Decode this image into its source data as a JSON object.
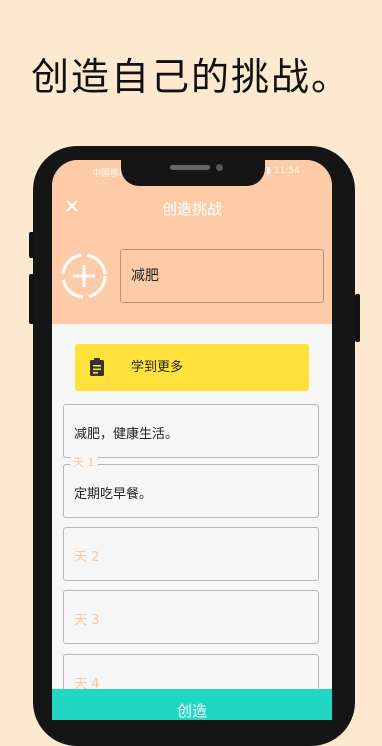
{
  "headline": "创造自己的挑战。",
  "status_bar": {
    "left": "中国移动 ⊕ ▾",
    "right": "◎ ▾ ▮ 11:54"
  },
  "header": {
    "title": "创造挑战",
    "challenge_name": "减肥"
  },
  "learn_more": {
    "label": "学到更多"
  },
  "description": {
    "value": "减肥，健康生活。"
  },
  "days": [
    {
      "label": "天 1",
      "value": "定期吃早餐。"
    },
    {
      "label": "天 2",
      "value": ""
    },
    {
      "label": "天 3",
      "value": ""
    },
    {
      "label": "天 4",
      "value": ""
    }
  ],
  "create_button": {
    "label": "创造"
  },
  "icons": {
    "close": "close-icon",
    "avatar": "add-photo-icon",
    "learn": "clipboard-icon"
  },
  "colors": {
    "header": "#fecba8",
    "learn": "#ffe23b",
    "create": "#22d6c4",
    "page": "#fde9cf"
  }
}
